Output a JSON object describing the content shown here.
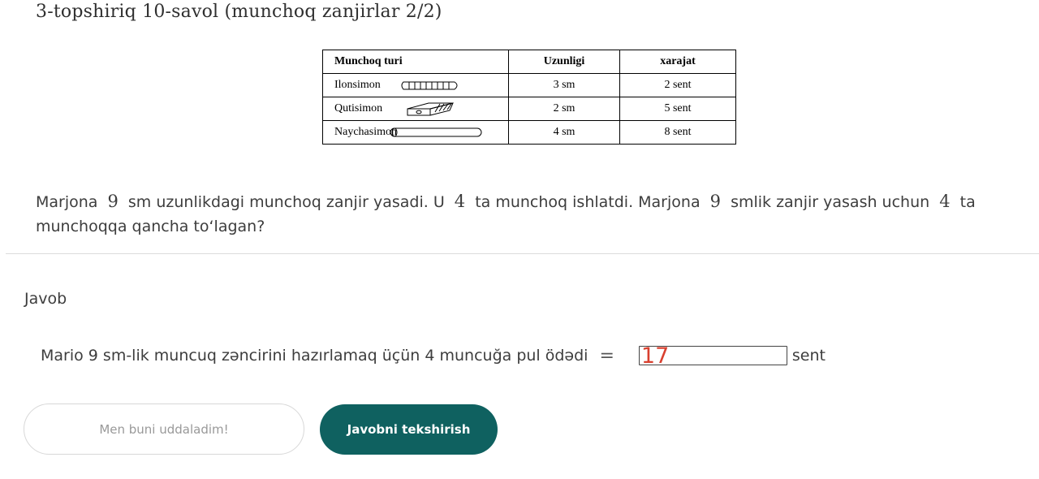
{
  "title": "3-topshiriq 10-savol (munchoq zanjirlar 2/2)",
  "table": {
    "headers": [
      "Munchoq turi",
      "Uzunligi",
      "xarajat"
    ],
    "rows": [
      {
        "name": "Ilonsimon",
        "length": "3 sm",
        "cost": "2 sent",
        "icon": "snake-bead-icon"
      },
      {
        "name": "Qutisimon",
        "length": "2 sm",
        "cost": "5 sent",
        "icon": "box-bead-icon"
      },
      {
        "name": "Naychasimon",
        "length": "4 sm",
        "cost": "8 sent",
        "icon": "tube-bead-icon"
      }
    ]
  },
  "question": {
    "part1": "Marjona",
    "num1": "9",
    "part2": "sm uzunlikdagi munchoq zanjir yasadi. U",
    "num2": "4",
    "part3": "ta munchoq ishlatdi. Marjona",
    "num3": "9",
    "part4": "smlik zanjir yasash uchun",
    "num4": "4",
    "part5": "ta munchoqqa qancha to‘lagan?"
  },
  "answer": {
    "label": "Javob",
    "sentence": "Mario 9 sm-lik muncuq zəncirini hazırlamaq üçün 4 muncuğa pul ödədi",
    "equals": "=",
    "value": "17",
    "unit": "sent"
  },
  "buttons": {
    "secondary": "Men buni uddaladim!",
    "primary": "Javobni tekshirish"
  },
  "colors": {
    "primary_button": "#0f6160",
    "answer_value": "#d9402f"
  }
}
